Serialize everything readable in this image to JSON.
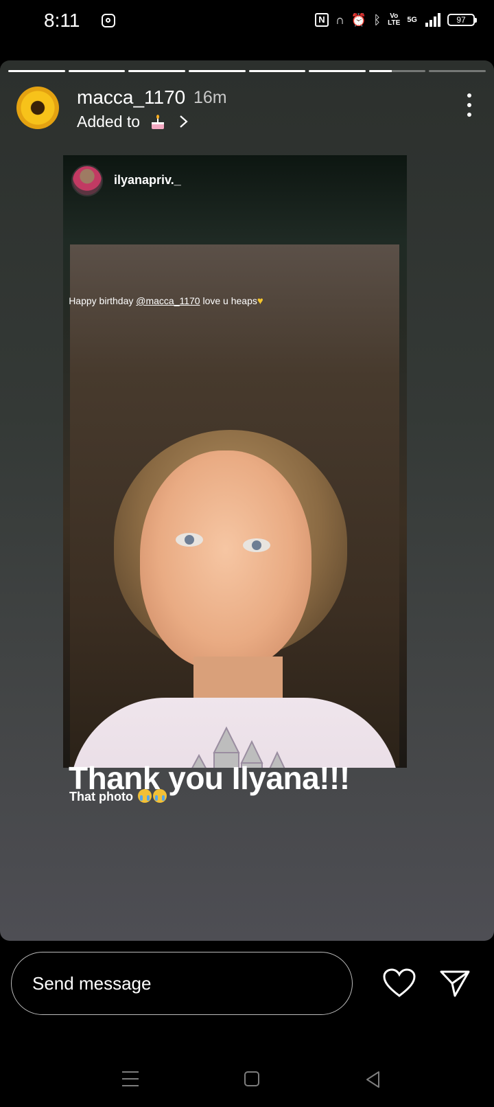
{
  "status_bar": {
    "time": "8:11",
    "icons": [
      "instagram-icon",
      "nfc-icon",
      "headphones-icon",
      "alarm-icon",
      "bluetooth-icon",
      "volte-icon",
      "5g-icon",
      "signal-icon",
      "battery-icon"
    ],
    "volte": "Vo\nLTE",
    "network": "5G",
    "battery": "97"
  },
  "story": {
    "progress": [
      1,
      1,
      1,
      1,
      1,
      1,
      0.4,
      0
    ],
    "username": "macca_1170",
    "time_ago": "16m",
    "added_to": "Added to",
    "embedded": {
      "username": "ilyanapriv._",
      "caption_prefix": "Happy birthday ",
      "mention": "@macca_1170",
      "caption_suffix": " love u heaps"
    },
    "headline": "Thank you Ilyana!!!",
    "subtext": "That photo"
  },
  "reply": {
    "placeholder": "Send message"
  },
  "colors": {
    "accent_heart": "#f4c42c",
    "background": "#000000"
  }
}
